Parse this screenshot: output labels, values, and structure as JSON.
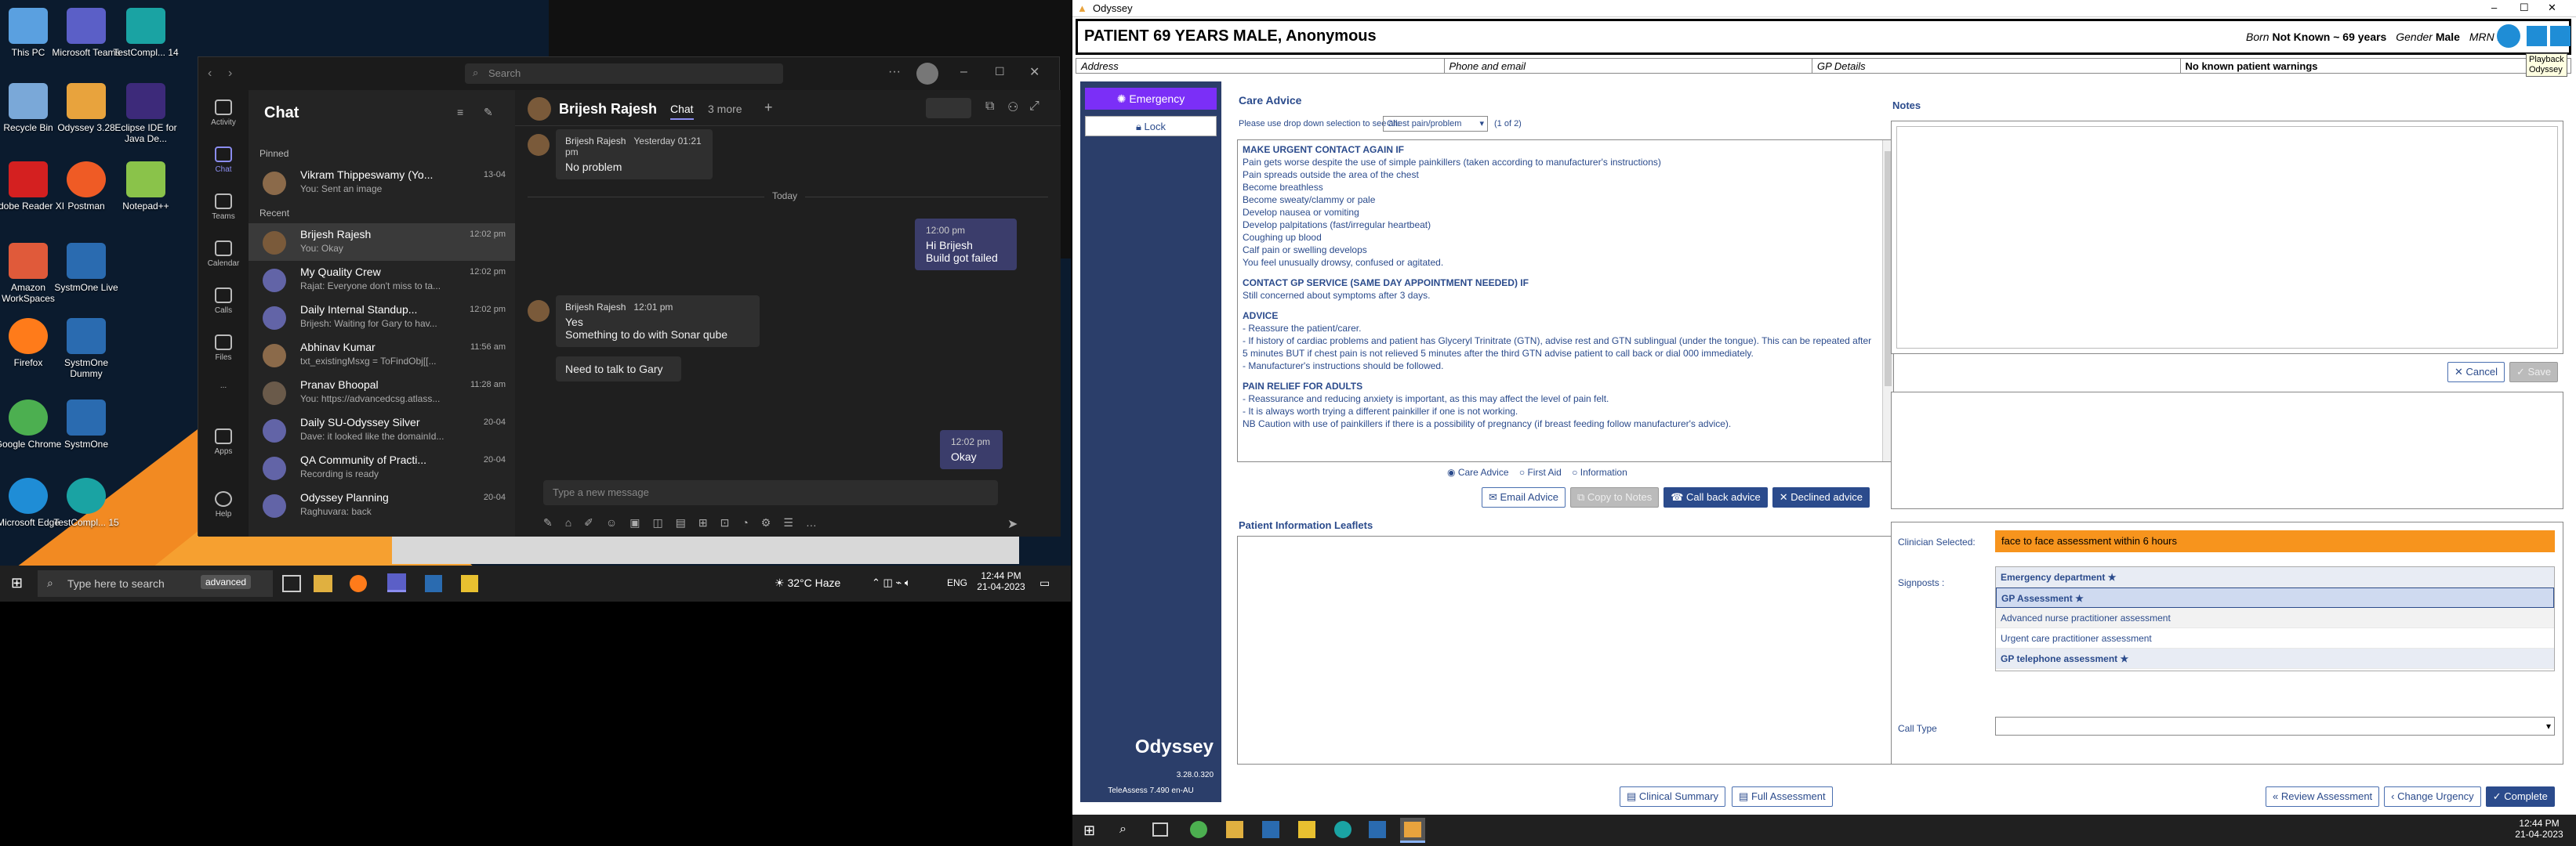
{
  "desktop": {
    "icons": [
      {
        "label": "This PC",
        "color": "#5aa0e0"
      },
      {
        "label": "Microsoft Teams",
        "color": "#5b5fc7"
      },
      {
        "label": "TestCompl... 14",
        "color": "#1aa3a3"
      },
      {
        "label": "Recycle Bin",
        "color": "#7aa8d8"
      },
      {
        "label": "Odyssey 3.28",
        "color": "#e8a33d"
      },
      {
        "label": "Eclipse IDE for Java De...",
        "color": "#3d2a7a"
      },
      {
        "label": "Adobe Reader XI",
        "color": "#d42020"
      },
      {
        "label": "Postman",
        "color": "#ef5b25"
      },
      {
        "label": "Notepad++",
        "color": "#8ac34a"
      },
      {
        "label": "Amazon WorkSpaces",
        "color": "#e05a3a"
      },
      {
        "label": "SystmOne Live",
        "color": "#2a6bb0"
      },
      {
        "label": "Firefox",
        "color": "#ff7b1a"
      },
      {
        "label": "SystmOne Dummy",
        "color": "#2a6bb0"
      },
      {
        "label": "Google Chrome",
        "color": "#4caf50"
      },
      {
        "label": "SystmOne",
        "color": "#2a6bb0"
      },
      {
        "label": "Microsoft Edge",
        "color": "#1f8dd6"
      },
      {
        "label": "TestCompl... 15",
        "color": "#1aa3a3"
      }
    ]
  },
  "teams": {
    "search_placeholder": "Search",
    "rail": [
      "Activity",
      "Chat",
      "Teams",
      "Calendar",
      "Calls",
      "Files",
      "...",
      "Apps",
      "Help"
    ],
    "chat_header": "Chat",
    "pinned_label": "Pinned",
    "recent_label": "Recent",
    "chats": [
      {
        "name": "Vikram Thippeswamy (Yo...",
        "preview": "You: Sent an image",
        "time": "13-04"
      },
      {
        "name": "Brijesh Rajesh",
        "preview": "You: Okay",
        "time": "12:02 pm"
      },
      {
        "name": "My Quality Crew",
        "preview": "Rajat: Everyone don't miss to ta...",
        "time": "12:02 pm"
      },
      {
        "name": "Daily Internal Standup...",
        "preview": "Brijesh: Waiting for Gary to hav...",
        "time": "12:02 pm"
      },
      {
        "name": "Abhinav Kumar",
        "preview": "txt_existingMsxg = ToFindObj[[...",
        "time": "11:56 am"
      },
      {
        "name": "Pranav Bhoopal",
        "preview": "You: https://advancedcsg.atlass...",
        "time": "11:28 am"
      },
      {
        "name": "Daily SU-Odyssey Silver",
        "preview": "Dave: it looked like the domainId...",
        "time": "20-04"
      },
      {
        "name": "QA Community of Practi...",
        "preview": "Recording is ready",
        "time": "20-04"
      },
      {
        "name": "Odyssey Planning",
        "preview": "Raghuvara: back",
        "time": "20-04"
      }
    ],
    "conversation": {
      "contact": "Brijesh Rajesh",
      "tab_chat": "Chat",
      "tab_more": "3 more",
      "msg1_sender": "Brijesh Rajesh",
      "msg1_time": "Yesterday 01:21 pm",
      "msg1_text": "No problem",
      "today": "Today",
      "mine1_time": "12:00 pm",
      "mine1_line1": "Hi Brijesh",
      "mine1_line2": "Build got failed",
      "msg2_sender": "Brijesh Rajesh",
      "msg2_time": "12:01 pm",
      "msg2_line1": "Yes",
      "msg2_line2": "Something to do with Sonar qube",
      "msg2_line3": "Need to talk to Gary",
      "mine2_time": "12:02 pm",
      "mine2_text": "Okay",
      "compose_placeholder": "Type a new message"
    }
  },
  "left_taskbar": {
    "search_placeholder": "Type here to search",
    "search_badge": "advanced",
    "weather": "32°C Haze",
    "lang": "ENG",
    "time": "12:44 PM",
    "date": "21-04-2023"
  },
  "odyssey": {
    "window_title": "Odyssey",
    "patient_title": "PATIENT 69 YEARS MALE, Anonymous",
    "born_label": "Born",
    "born_value": "Not Known ~ 69 years",
    "gender_label": "Gender",
    "gender_value": "Male",
    "mrn_label": "MRN no",
    "playback_tooltip_1": "Playback",
    "playback_tooltip_2": "Odyssey",
    "address": "Address",
    "phone": "Phone and email",
    "gp": "GP Details",
    "warnings": "No known patient warnings",
    "emergency": "Emergency",
    "lock": "Lock",
    "brand": "Odyssey",
    "version": "3.28.0.320",
    "teleassess": "TeleAssess 7.490 en-AU",
    "care_advice_title": "Care Advice",
    "dropdown_hint": "Please use drop down selection to see all:",
    "dropdown_value": "Chest pain/problem",
    "page_indicator": "(1 of 2)",
    "advice": {
      "urgent_title": "MAKE URGENT CONTACT AGAIN IF",
      "urgent_lines": [
        "Pain gets worse despite the use of simple painkillers (taken according to manufacturer's instructions)",
        "Pain spreads outside the area of the chest",
        "Become breathless",
        "Become sweaty/clammy or pale",
        "Develop nausea or vomiting",
        "Develop palpitations (fast/irregular heartbeat)",
        "Coughing up blood",
        "Calf pain or swelling develops",
        "You feel unusually drowsy, confused or agitated."
      ],
      "gp_title": "CONTACT GP SERVICE (SAME DAY APPOINTMENT NEEDED) IF",
      "gp_lines": [
        "Still concerned about symptoms after 3 days."
      ],
      "advice_title": "ADVICE",
      "advice_lines": [
        "- Reassure the patient/carer.",
        "- If history of cardiac problems and patient has Glyceryl Trinitrate (GTN), advise rest and GTN sublingual (under the tongue). This can be repeated after 5 minutes BUT if chest pain is not relieved 5 minutes after the third GTN advise patient to call back or dial 000 immediately.",
        "- Manufacturer's instructions should be followed."
      ],
      "pain_title": "PAIN RELIEF FOR ADULTS",
      "pain_lines": [
        "- Reassurance and reducing anxiety is important, as this may affect the level of pain felt.",
        "- It is always worth trying a different painkiller if one is not working.",
        "NB Caution with use of painkillers if there is a possibility of pregnancy (if breast feeding follow manufacturer's advice)."
      ]
    },
    "radio_care": "Care Advice",
    "radio_first": "First Aid",
    "radio_info": "Information",
    "btn_email": "Email Advice",
    "btn_copy": "Copy to Notes",
    "btn_callback": "Call back advice",
    "btn_declined": "Declined advice",
    "leaflets_title": "Patient Information Leaflets",
    "notes_title": "Notes",
    "btn_cancel": "Cancel",
    "btn_save": "Save",
    "clinician_label": "Clinician Selected:",
    "clinician_value": "face to face assessment within 6 hours",
    "signposts_label": "Signposts :",
    "signposts": [
      {
        "label": "Emergency department",
        "star": true,
        "bold": true
      },
      {
        "label": "GP Assessment",
        "star": true,
        "bold": true
      },
      {
        "label": "Advanced nurse practitioner assessment",
        "star": false,
        "bold": false
      },
      {
        "label": "Urgent care practitioner assessment",
        "star": false,
        "bold": false
      },
      {
        "label": "GP telephone assessment",
        "star": true,
        "bold": true
      }
    ],
    "calltype_label": "Call Type",
    "btn_clinical": "Clinical Summary",
    "btn_full": "Full Assessment",
    "btn_review": "Review Assessment",
    "btn_change": "Change Urgency",
    "btn_complete": "Complete"
  },
  "right_taskbar": {
    "time": "12:44 PM",
    "date": "21-04-2023"
  },
  "colors": {
    "accent": "#2b4b8c",
    "emergency": "#7b2ff7",
    "clinician": "#f7941d",
    "teams_purple": "#5b5fc7"
  }
}
